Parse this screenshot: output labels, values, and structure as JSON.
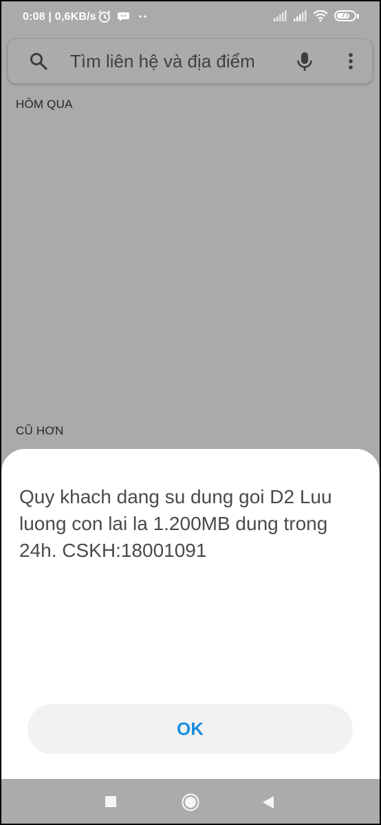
{
  "status_bar": {
    "text": "0:08 | 0,6KB/s",
    "icons_left": [
      "alarm-icon",
      "chat-bubble-icon",
      "more-dots-icon"
    ],
    "icons_right": [
      "signal-icon",
      "signal-icon",
      "wifi-icon",
      "battery-icon"
    ],
    "battery_level": "77"
  },
  "search": {
    "placeholder": "Tìm liên hệ và địa điểm",
    "value": "",
    "icons": [
      "search-icon",
      "mic-icon",
      "more-vert-icon"
    ]
  },
  "sections": {
    "yesterday": "HÔM QUA",
    "older": "CŨ HƠN"
  },
  "dialog": {
    "message": "Quy khach dang su dung goi D2 Luu luong con lai la 1.200MB dung trong 24h. CSKH:18001091",
    "ok_label": "OK"
  },
  "nav": {
    "buttons": [
      "recents-square-icon",
      "home-circle-icon",
      "back-triangle-icon"
    ]
  },
  "colors": {
    "dim_background": "#aaaaaa",
    "accent": "#1a8fe0",
    "dialog_bg": "#ffffff",
    "button_bg": "#f2f2f2"
  }
}
